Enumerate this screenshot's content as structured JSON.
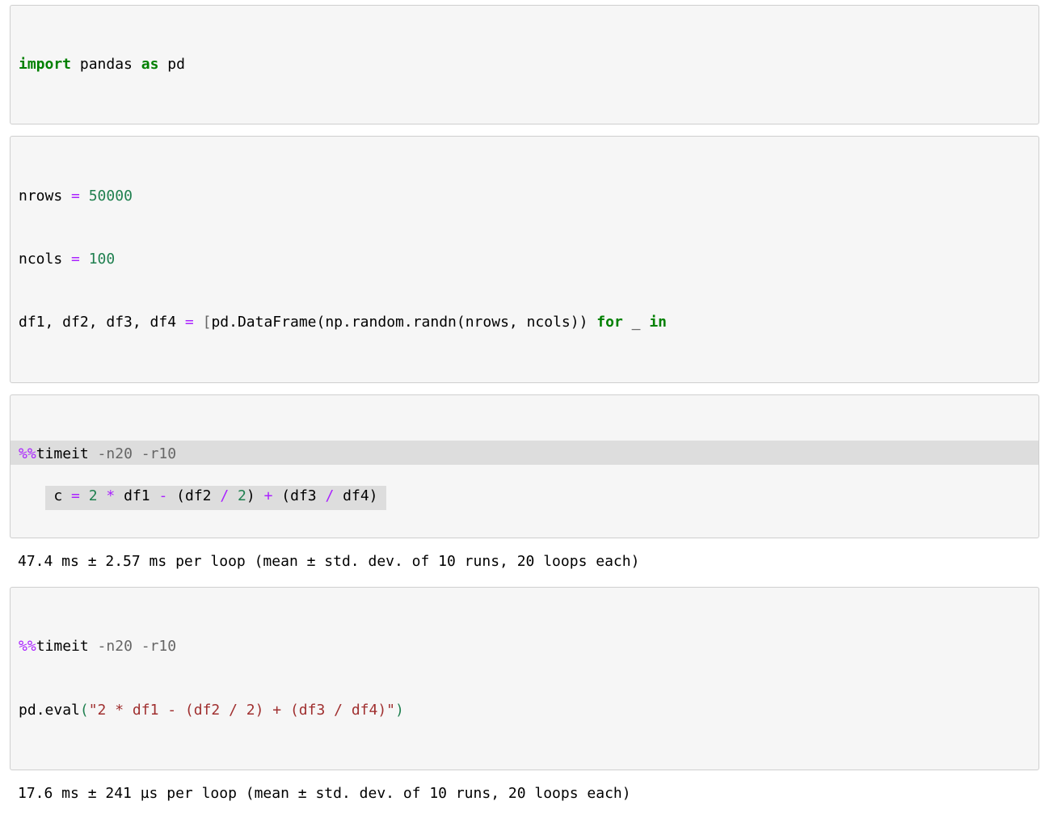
{
  "cell1": {
    "import": "import",
    "pandas": "pandas",
    "as": "as",
    "pd": "pd"
  },
  "cell2": {
    "l1_nrows": "nrows",
    "l1_eq": "=",
    "l1_val": "50000",
    "l2_ncols": "ncols",
    "l2_eq": "=",
    "l2_val": "100",
    "l3_lhs": "df1, df2, df3, df4",
    "l3_eq": "=",
    "l3_lbrack": "[",
    "l3_call": "pd.DataFrame(np.random.randn(nrows, ncols))",
    "l3_for": "for",
    "l3_under": "_",
    "l3_in": "in"
  },
  "cell3": {
    "l1_pct": "%%",
    "l1_timeit": "timeit",
    "l1_args": " -n20 -r10",
    "l2_c": "c",
    "l2_eq": "=",
    "l2_two": "2",
    "l2_star1": "*",
    "l2_df1": "df1",
    "l2_minus": "-",
    "l2_p2a": "(df2",
    "l2_slash1": "/",
    "l2_twoB": "2",
    "l2_p2b": ")",
    "l2_plus": "+",
    "l2_p3a": "(df3",
    "l2_slash2": "/",
    "l2_df4": "df4)"
  },
  "out3": "47.4 ms ± 2.57 ms per loop (mean ± std. dev. of 10 runs, 20 loops each)",
  "cell4": {
    "l1_pct": "%%",
    "l1_timeit": "timeit",
    "l1_args": " -n20 -r10",
    "l2_pd": "pd",
    "l2_eval": ".eval",
    "l2_open": "(",
    "l2_str": "\"2 * df1 - (df2 / 2) + (df3 / df4)\"",
    "l2_close": ")"
  },
  "out4": "17.6 ms ± 241 µs per loop (mean ± std. dev. of 10 runs, 20 loops each)"
}
